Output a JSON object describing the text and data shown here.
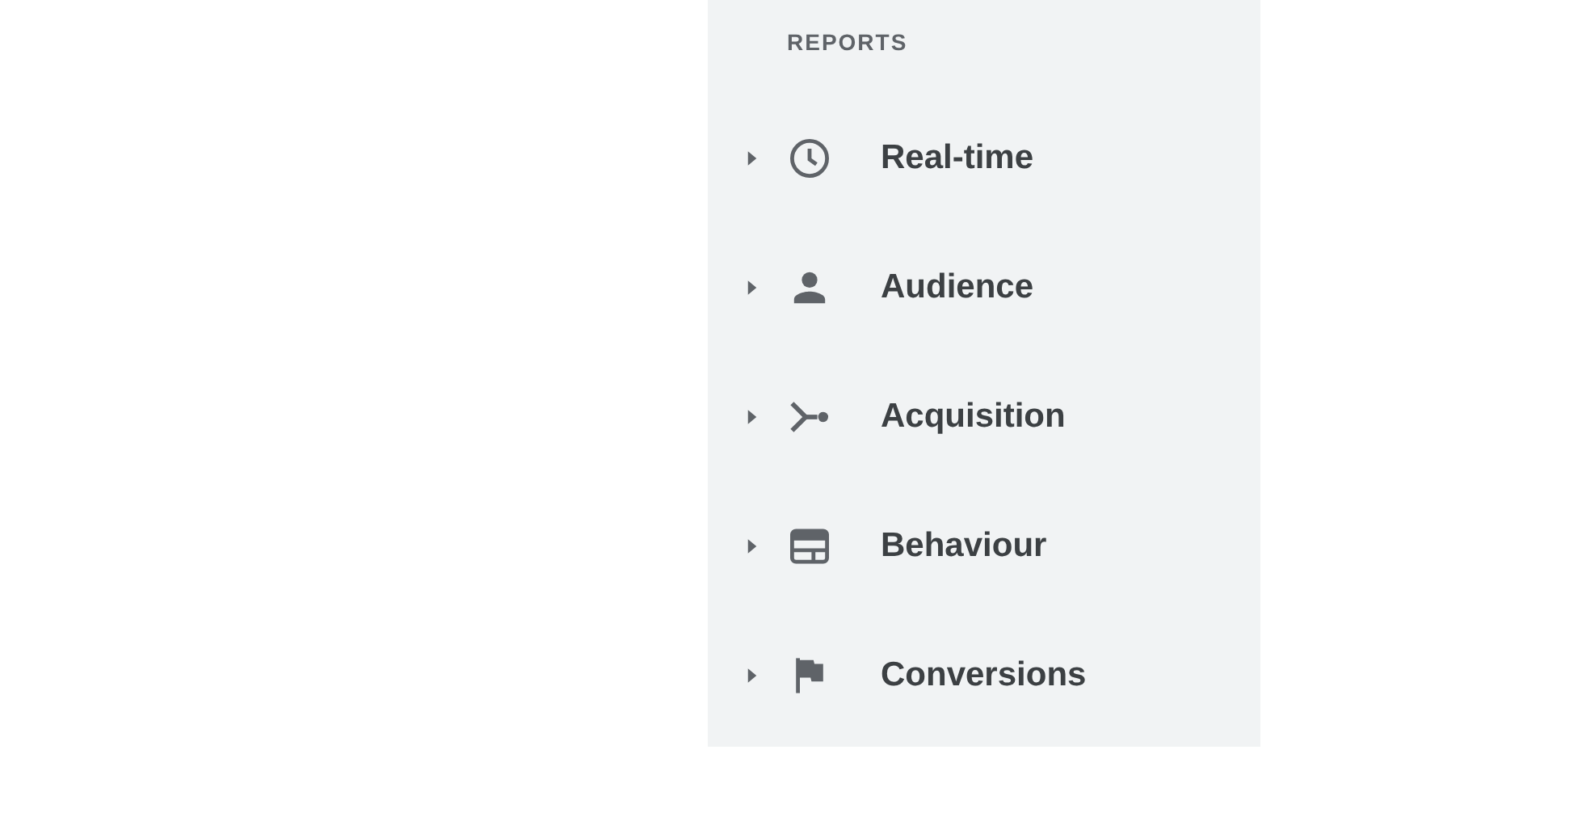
{
  "sidebar": {
    "heading": "REPORTS",
    "items": [
      {
        "label": "Real-time",
        "kind": "clock",
        "expanded": false
      },
      {
        "label": "Audience",
        "kind": "person",
        "expanded": false
      },
      {
        "label": "Acquisition",
        "kind": "branch",
        "expanded": false
      },
      {
        "label": "Behaviour",
        "kind": "window",
        "expanded": false
      },
      {
        "label": "Conversions",
        "kind": "flag",
        "expanded": false
      }
    ]
  }
}
